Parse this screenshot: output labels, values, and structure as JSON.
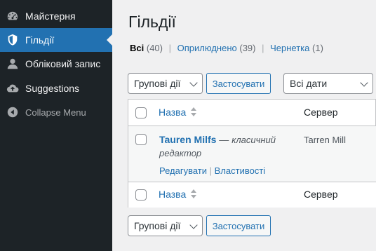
{
  "sidebar": {
    "items": [
      {
        "label": "Майстерня",
        "icon": "dashboard-icon"
      },
      {
        "label": "Гільдії",
        "icon": "shield-icon",
        "active": true
      },
      {
        "label": "Обліковий запис",
        "icon": "user-icon"
      },
      {
        "label": "Suggestions",
        "icon": "cloud-upload-icon"
      },
      {
        "label": "Collapse Menu",
        "icon": "collapse-icon"
      }
    ]
  },
  "main": {
    "title": "Гільдії",
    "filters": [
      {
        "label": "Всі",
        "count": "(40)",
        "current": true
      },
      {
        "label": "Оприлюднено",
        "count": "(39)"
      },
      {
        "label": "Чернетка",
        "count": "(1)"
      }
    ],
    "bulk_select_value": "Групові дії",
    "apply_label": "Застосувати",
    "date_select_value": "Всі дати",
    "table": {
      "col_title": "Назва",
      "col_server": "Сервер",
      "rows": [
        {
          "title": "Tauren Milfs",
          "state_sep": " — ",
          "state": "класичний редактор",
          "server": "Tarren Mill",
          "actions": [
            "Редагувати",
            "Властивості"
          ]
        }
      ]
    }
  },
  "colors": {
    "sidebar_bg": "#1d2327",
    "accent": "#2271b1",
    "page_bg": "#f0f0f1"
  }
}
